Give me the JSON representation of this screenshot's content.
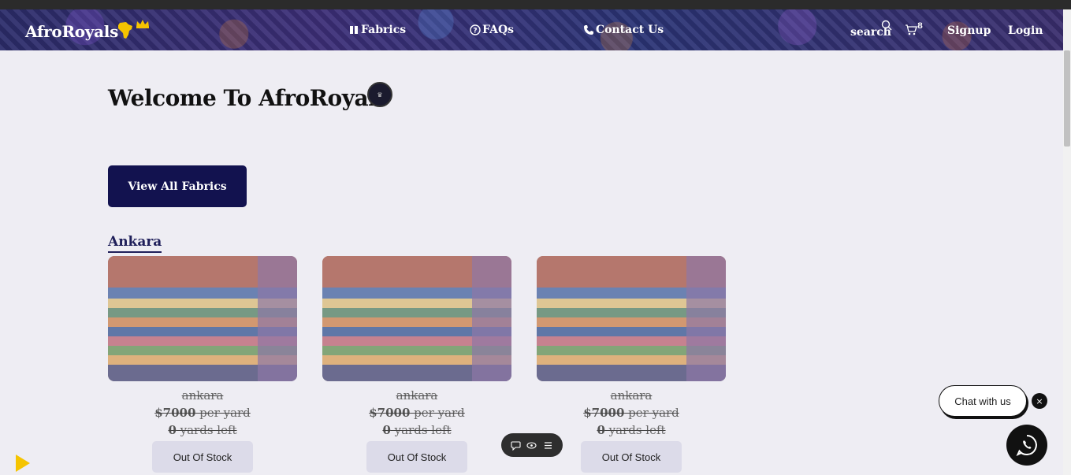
{
  "header": {
    "logo_text": "AfroRoyals",
    "nav": [
      {
        "label": "Fabrics",
        "icon": "book-icon"
      },
      {
        "label": "FAQs",
        "icon": "question-circle-icon"
      },
      {
        "label": "Contact Us",
        "icon": "phone-icon"
      }
    ],
    "search_label": "search",
    "cart_count": "8",
    "signup_label": "Signup",
    "login_label": "Login"
  },
  "main": {
    "title": "Welcome To AfroRoyals",
    "view_all_label": "View All Fabrics",
    "category": "Ankara",
    "products": [
      {
        "name": "ankara",
        "price": "$7000",
        "unit": " per yard",
        "stock": "0",
        "stock_suffix": " yards left",
        "button": "Out Of Stock"
      },
      {
        "name": "ankara",
        "price": "$7000",
        "unit": " per yard",
        "stock": "0",
        "stock_suffix": " yards left",
        "button": "Out Of Stock"
      },
      {
        "name": "ankara",
        "price": "$7000",
        "unit": " per yard",
        "stock": "0",
        "stock_suffix": " yards left",
        "button": "Out Of Stock"
      }
    ]
  },
  "chat": {
    "label": "Chat with us",
    "close": "×"
  },
  "colors": {
    "primary": "#12124f",
    "background": "#eeedf3",
    "button_disabled": "#dcdbe9",
    "accent_yellow": "#f5c400"
  }
}
